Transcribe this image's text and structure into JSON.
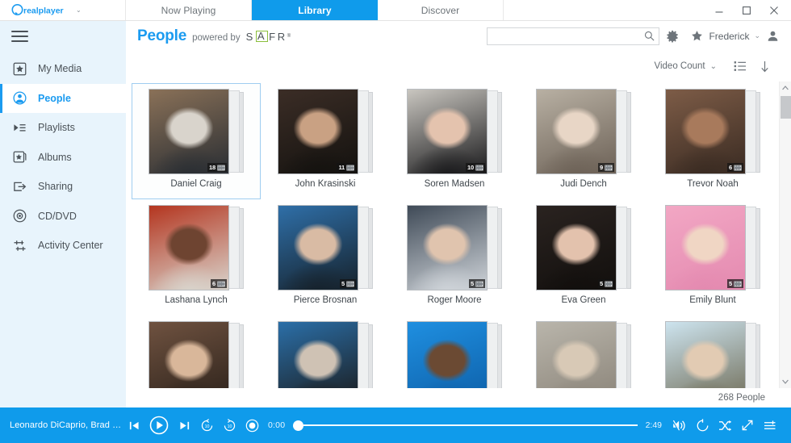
{
  "titlebar": {
    "brand": "realplayer",
    "brand_caret": "⌄",
    "tabs": [
      {
        "label": "Now Playing",
        "active": false
      },
      {
        "label": "Library",
        "active": true
      },
      {
        "label": "Discover",
        "active": false
      }
    ],
    "window_buttons": [
      "minimize-button",
      "maximize-button",
      "close-button"
    ]
  },
  "header": {
    "menu_icon": "hamburger-icon",
    "page_title": "People",
    "powered_by": "powered by",
    "safr_s": "S",
    "safr_a": "A",
    "safr_f": "F",
    "safr_r": "R",
    "safr_tm": "®",
    "search_placeholder": "",
    "search_value": "",
    "settings_icon": "gear-icon",
    "favorite_icon": "star-icon",
    "username": "Frederick",
    "user_caret": "⌄",
    "account_icon": "person-icon"
  },
  "sidebar": {
    "items": [
      {
        "label": "My Media",
        "icon": "star-box-icon",
        "active": false
      },
      {
        "label": "People",
        "icon": "person-circle-icon",
        "active": true
      },
      {
        "label": "Playlists",
        "icon": "playlist-icon",
        "active": false
      },
      {
        "label": "Albums",
        "icon": "album-icon",
        "active": false
      },
      {
        "label": "Sharing",
        "icon": "share-arrow-icon",
        "active": false
      },
      {
        "label": "CD/DVD",
        "icon": "disc-icon",
        "active": false
      },
      {
        "label": "Activity Center",
        "icon": "activity-icon",
        "active": false
      }
    ]
  },
  "toolbar": {
    "sort_label": "Video Count",
    "sort_caret": "⌄",
    "list_view_icon": "list-view-icon",
    "sort_direction_icon": "arrow-down-icon"
  },
  "grid": {
    "people": [
      {
        "name": "Daniel Craig",
        "count": "18",
        "selected": true,
        "c1": "#8a7158",
        "c2": "#d9d4cc",
        "c3": "#2a2e33"
      },
      {
        "name": "John Krasinski",
        "count": "11",
        "selected": false,
        "c1": "#3b2d26",
        "c2": "#c9a183",
        "c3": "#14120f"
      },
      {
        "name": "Soren Madsen",
        "count": "10",
        "selected": false,
        "c1": "#c9c6c0",
        "c2": "#e4c3ae",
        "c3": "#1b1b1d"
      },
      {
        "name": "Judi Dench",
        "count": "9",
        "selected": false,
        "c1": "#b8b0a3",
        "c2": "#e8d6c6",
        "c3": "#6d6257"
      },
      {
        "name": "Trevor Noah",
        "count": "6",
        "selected": false,
        "c1": "#7d5c47",
        "c2": "#a87a5c",
        "c3": "#3a2b22"
      },
      {
        "name": "Lashana Lynch",
        "count": "6",
        "selected": false,
        "c1": "#b4351f",
        "c2": "#6e4431",
        "c3": "#d9d4cc"
      },
      {
        "name": "Pierce Brosnan",
        "count": "5",
        "selected": false,
        "c1": "#2f6fa8",
        "c2": "#d9bba4",
        "c3": "#16222c"
      },
      {
        "name": "Roger Moore",
        "count": "5",
        "selected": false,
        "c1": "#3f4a57",
        "c2": "#e0c4ae",
        "c3": "#cfd4d9"
      },
      {
        "name": "Eva Green",
        "count": "5",
        "selected": false,
        "c1": "#2a2320",
        "c2": "#e3c2ad",
        "c3": "#120f0d"
      },
      {
        "name": "Emily Blunt",
        "count": "5",
        "selected": false,
        "c1": "#f2a7c4",
        "c2": "#f0d6c4",
        "c3": "#e48ab0"
      }
    ],
    "partial_row": [
      {
        "name": "",
        "c1": "#6f5240",
        "c2": "#d9b79a",
        "c3": "#2b211a"
      },
      {
        "name": "",
        "c1": "#2b6fa8",
        "c2": "#cfc2b4",
        "c3": "#1a1a1a"
      },
      {
        "name": "",
        "c1": "#1f8fe0",
        "c2": "#6b4a33",
        "c3": "#0d5fa8"
      },
      {
        "name": "",
        "c1": "#b9b5ab",
        "c2": "#d8c9b6",
        "c3": "#8a8378"
      },
      {
        "name": "",
        "c1": "#cde4ef",
        "c2": "#e2cbb3",
        "c3": "#6e6a54"
      }
    ],
    "count_text": "268 People",
    "scroll_up_icon": "scroll-up-arrow",
    "scroll_down_icon": "scroll-down-arrow"
  },
  "player": {
    "now_playing": "Leonardo DiCaprio, Brad Pitt &...",
    "prev_icon": "previous-track-icon",
    "play_icon": "play-icon",
    "next_icon": "next-track-icon",
    "rewind_icon": "rewind-10-icon",
    "forward_icon": "forward-10-icon",
    "record_icon": "record-icon",
    "time_elapsed": "0:00",
    "time_total": "2:49",
    "mute_icon": "volume-mute-icon",
    "repeat_icon": "repeat-icon",
    "shuffle_icon": "shuffle-icon",
    "fullscreen_icon": "expand-icon",
    "playlist_icon": "playlist-queue-icon"
  },
  "colors": {
    "accent": "#0f9beb",
    "sidebar_bg": "#e8f4fc",
    "title_blue": "#1b9bf0"
  }
}
